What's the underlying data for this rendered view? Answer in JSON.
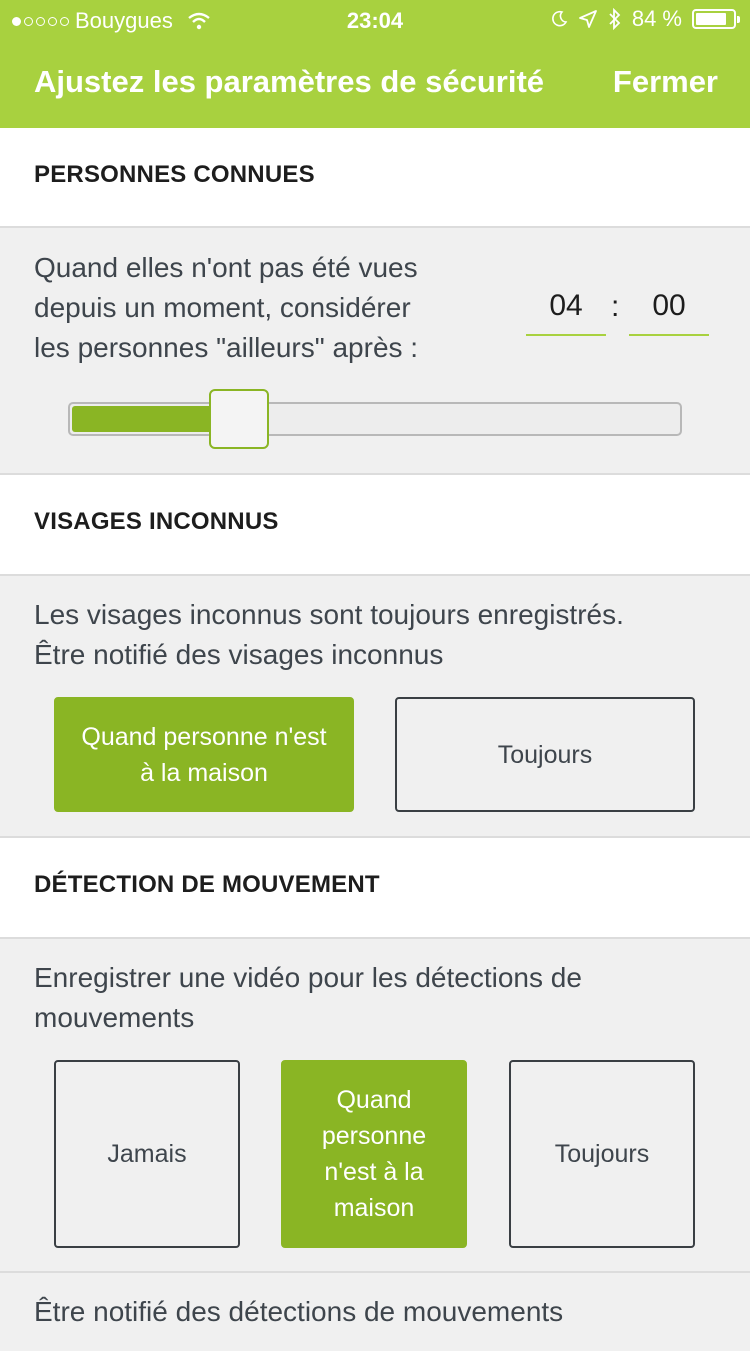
{
  "status_bar": {
    "carrier": "Bouygues",
    "time": "23:04",
    "battery": "84 %",
    "battery_level": 0.84
  },
  "nav": {
    "title": "Ajustez les paramètres de sécurité",
    "close_label": "Fermer"
  },
  "known_people": {
    "header": "PERSONNES CONNUES",
    "line1": "Quand elles n'ont pas été vues",
    "line2": "depuis un moment, considérer",
    "line3": "les personnes \"ailleurs\" après :",
    "hours": "04",
    "separator": ":",
    "minutes": "00",
    "slider_level": 0.25
  },
  "unknown_faces": {
    "header": "VISAGES INCONNUS",
    "line1": "Les visages inconnus sont toujours enregistrés.",
    "line2": "Être notifié des visages inconnus",
    "option_home_line1": "Quand personne n'est",
    "option_home_line2": "à la maison",
    "option_always": "Toujours",
    "selected": "home"
  },
  "motion": {
    "header": "DÉTECTION DE MOUVEMENT",
    "line1": "Enregistrer une vidéo pour les détections de",
    "line2": "mouvements",
    "option_never": "Jamais",
    "option_home_line1": "Quand",
    "option_home_line2": "personne",
    "option_home_line3": "n'est à la",
    "option_home_line4": "maison",
    "option_always": "Toujours",
    "selected": "home",
    "notify_text": "Être notifié des détections de mouvements"
  },
  "colors": {
    "accent": "#a8d13f",
    "active_button": "#8ab524",
    "panel_bg": "#f0f0f0"
  },
  "icons": [
    "signal-dots-icon",
    "wifi-icon",
    "moon-icon",
    "location-arrow-icon",
    "bluetooth-icon",
    "battery-icon"
  ]
}
